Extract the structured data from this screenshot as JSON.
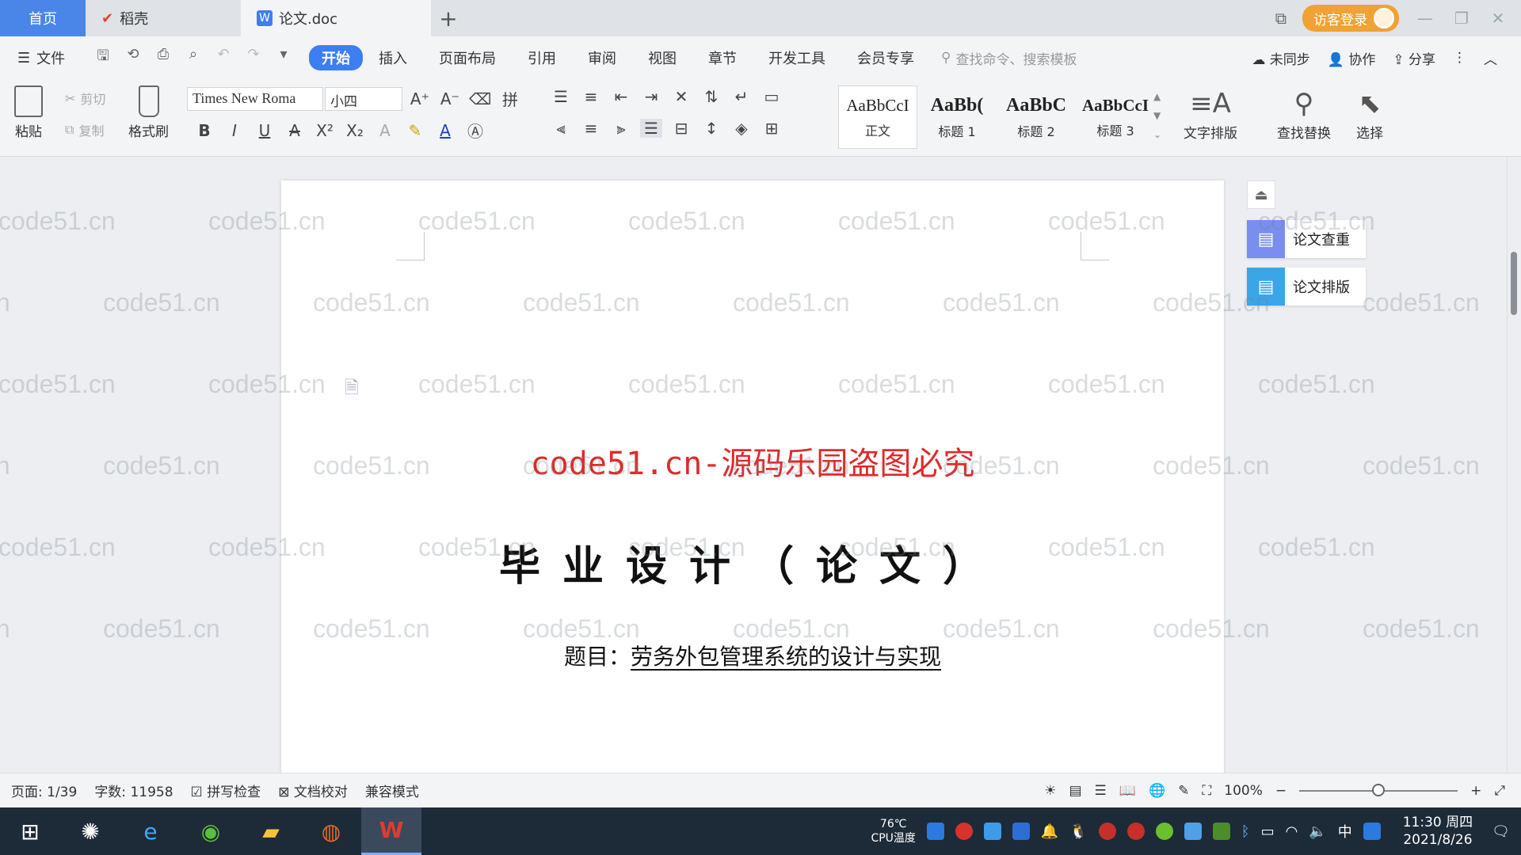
{
  "tabbar": {
    "home": "首页",
    "tabs": [
      {
        "label": "稻壳",
        "icon": "daoke-icon"
      },
      {
        "label": "论文.doc",
        "icon": "wps-writer-icon"
      }
    ],
    "login": "访客登录"
  },
  "menubar": {
    "file": "文件",
    "tabs": [
      "开始",
      "插入",
      "页面布局",
      "引用",
      "审阅",
      "视图",
      "章节",
      "开发工具",
      "会员专享"
    ],
    "active_tab": "开始",
    "search_placeholder": "查找命令、搜索模板",
    "right": [
      "未同步",
      "协作",
      "分享"
    ]
  },
  "ribbon": {
    "paste": "粘贴",
    "cut": "剪切",
    "copy": "复制",
    "format_painter": "格式刷",
    "font_name": "Times New Roma",
    "font_size": "小四",
    "styles": [
      {
        "sample": "AaBbCcI",
        "name": "正文"
      },
      {
        "sample": "AaBb(",
        "name": "标题 1"
      },
      {
        "sample": "AaBbC",
        "name": "标题 2"
      },
      {
        "sample": "AaBbCcI",
        "name": "标题 3"
      }
    ],
    "text_layout": "文字排版",
    "find_replace": "查找替换",
    "select": "选择"
  },
  "document": {
    "red_watermark": "code51.cn-源码乐园盗图必究",
    "title": "毕业设计（论文）",
    "subject_label": "题目：",
    "subject_value": "劳务外包管理系统的设计与实现"
  },
  "side_panel": {
    "plagiarism_check": "论文查重",
    "thesis_format": "论文排版"
  },
  "watermark_text": "code51.cn",
  "statusbar": {
    "page": "页面: 1/39",
    "word_count": "字数: 11958",
    "spell_check": "拼写检查",
    "doc_proof": "文档校对",
    "compat_mode": "兼容模式",
    "zoom": "100%"
  },
  "taskbar": {
    "cpu_temp": "76℃",
    "cpu_label": "CPU温度",
    "time": "11:30 周四",
    "date": "2021/8/26",
    "ime": "中"
  },
  "colors": {
    "accent": "#3d7ef2",
    "home_tab": "#4a86e8",
    "login_btn": "#f0a232",
    "red_watermark": "#e02a2a"
  }
}
